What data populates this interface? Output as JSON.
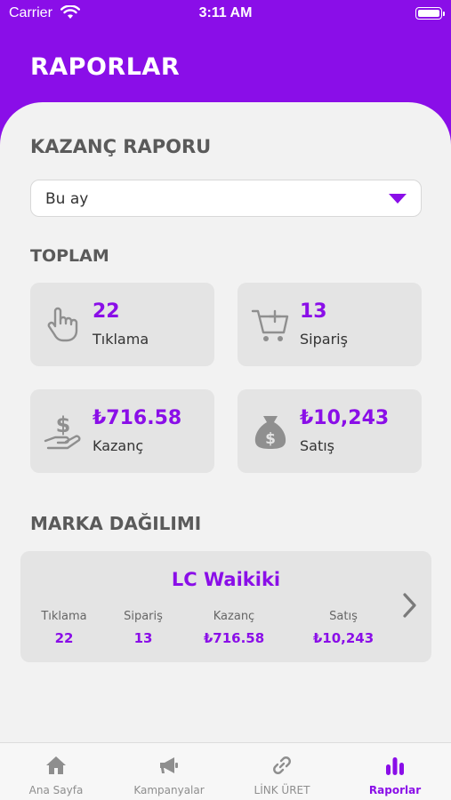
{
  "status_bar": {
    "carrier": "Carrier",
    "time": "3:11 AM"
  },
  "header": {
    "title": "RAPORLAR"
  },
  "report": {
    "title": "KAZANÇ RAPORU",
    "period_value": "Bu ay",
    "total_title": "TOPLAM",
    "stats": [
      {
        "value": "22",
        "label": "Tıklama",
        "icon": "hand-pointer-icon"
      },
      {
        "value": "13",
        "label": "Sipariş",
        "icon": "cart-plus-icon"
      },
      {
        "value": "₺716.58",
        "label": "Kazanç",
        "icon": "hand-dollar-icon"
      },
      {
        "value": "₺10,243",
        "label": "Satış",
        "icon": "money-bag-icon"
      }
    ]
  },
  "brand_distribution": {
    "title": "MARKA DAĞILIMI",
    "brand": "LC Waikiki",
    "columns": [
      {
        "header": "Tıklama",
        "value": "22"
      },
      {
        "header": "Sipariş",
        "value": "13"
      },
      {
        "header": "Kazanç",
        "value": "₺716.58"
      },
      {
        "header": "Satış",
        "value": "₺10,243"
      }
    ]
  },
  "tabbar": {
    "items": [
      {
        "label": "Ana Sayfa",
        "icon": "home-icon"
      },
      {
        "label": "Kampanyalar",
        "icon": "megaphone-icon"
      },
      {
        "label": "LİNK ÜRET",
        "icon": "link-icon"
      },
      {
        "label": "Raporlar",
        "icon": "bar-chart-icon",
        "active": true
      }
    ]
  },
  "colors": {
    "accent": "#8a0ee8",
    "panel": "#f2f2f2",
    "card": "#e4e4e4"
  }
}
